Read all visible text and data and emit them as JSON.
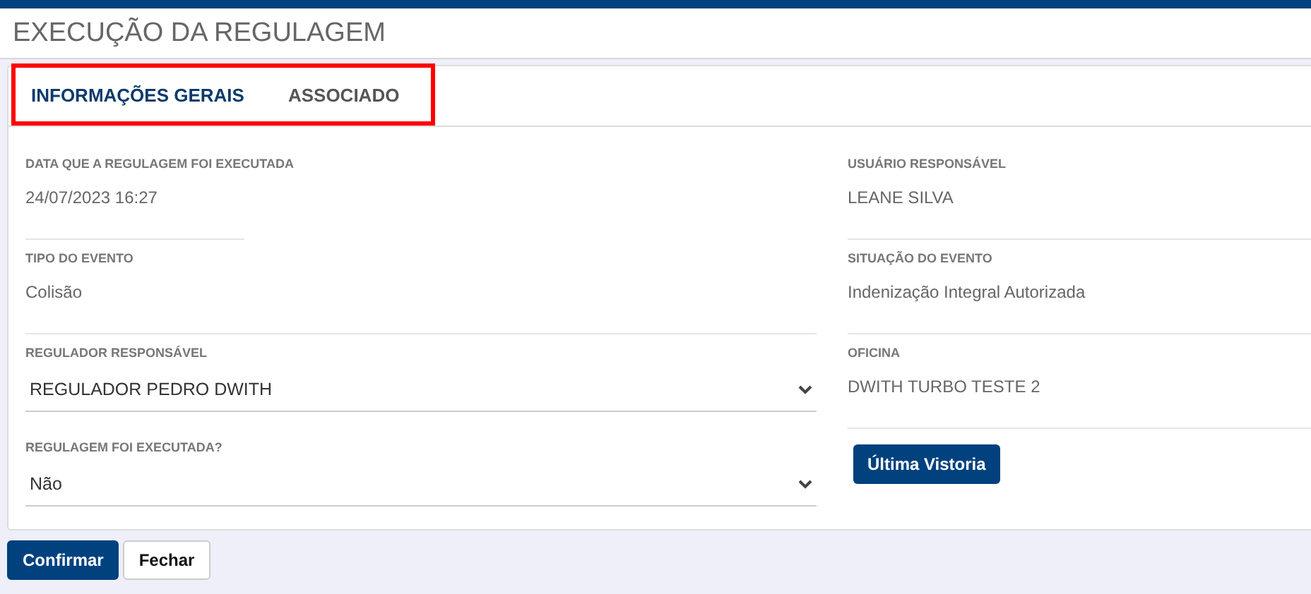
{
  "title": "EXECUÇÃO DA REGULAGEM",
  "tabs": [
    {
      "label": "INFORMAÇÕES GERAIS",
      "selected": true
    },
    {
      "label": "ASSOCIADO",
      "selected": false
    }
  ],
  "left_fields": [
    {
      "kind": "static",
      "label": "DATA QUE A REGULAGEM FOI EXECUTADA",
      "value": "24/07/2023 16:27",
      "narrow": true
    },
    {
      "kind": "static",
      "label": "TIPO DO EVENTO",
      "value": "Colisão"
    },
    {
      "kind": "select",
      "label": "REGULADOR RESPONSÁVEL",
      "value": "REGULADOR PEDRO DWITH"
    },
    {
      "kind": "select",
      "label": "REGULAGEM FOI EXECUTADA?",
      "value": "Não"
    }
  ],
  "right_fields": [
    {
      "kind": "static",
      "label": "USUÁRIO RESPONSÁVEL",
      "value": "LEANE SILVA"
    },
    {
      "kind": "static",
      "label": "SITUAÇÃO DO EVENTO",
      "value": "Indenização Integral Autorizada"
    },
    {
      "kind": "static",
      "label": "OFICINA",
      "value": "DWITH TURBO TESTE 2"
    }
  ],
  "side_button": "Última Vistoria",
  "buttons": [
    {
      "label": "Confirmar",
      "primary": true
    },
    {
      "label": "Fechar",
      "primary": false
    }
  ]
}
